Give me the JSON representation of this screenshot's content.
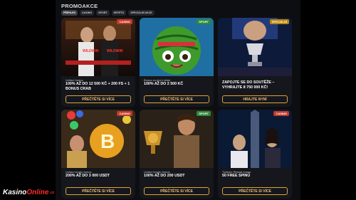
{
  "page": {
    "title": "PROMOAKCE"
  },
  "filters": [
    "PŘEHLED",
    "KASINO",
    "SPORT",
    "KRYPTO",
    "SPECIÁLNÍ AKCE"
  ],
  "cards": [
    {
      "tag": "CASINO",
      "sub": "Uvítací bonus",
      "headline": "100% AŽ DO 12 500 KČ + 200 FS + 1 BONUS CRAB",
      "button": "PŘEČTĚTE SI VÍCE"
    },
    {
      "tag": "SPORT",
      "sub": "Bonus za první vklad",
      "headline": "100% AŽ DO 2 500 KČ",
      "button": "PŘEČTĚTE SI VÍCE"
    },
    {
      "tag": "SPECIÁLNÍ",
      "sub": "",
      "headline": "ZAPOJTE SE DO SOUTĚŽE – VYHRAJTE 8 750 000 KČ!",
      "button": "HRAJTE NYNÍ"
    },
    {
      "tag": "CASINO",
      "sub": "Uvítací krypto bonus",
      "headline": "200% AŽ DO 3 000 USDT",
      "button": "PŘEČTĚTE SI VÍCE"
    },
    {
      "tag": "SPORT",
      "sub": "Uvítací krypto bonus",
      "headline": "100% AŽ DO 200 USDT",
      "button": "PŘEČTĚTE SI VÍCE"
    },
    {
      "tag": "CASINO",
      "sub": "Týdenní Reload bonus",
      "headline": "50 FREE SPINŮ",
      "button": "PŘEČTĚTE SI VÍCE"
    }
  ],
  "watermark": {
    "part1": "Kasino",
    "part2": "Online",
    "part3": ".cz"
  }
}
